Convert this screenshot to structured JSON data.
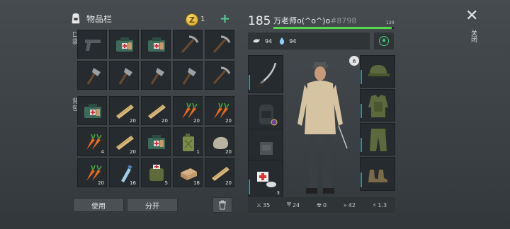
{
  "inventory": {
    "title": "物品栏",
    "coins": "1",
    "plus_label": "+",
    "pocket_label": "口袋",
    "backpack_label": "背包",
    "pocket_rows": [
      [
        {
          "icon": "pistol-icon",
          "count": ""
        },
        {
          "icon": "medkit-bag-icon",
          "count": ""
        },
        {
          "icon": "medkit-bag-icon",
          "count": ""
        },
        {
          "icon": "pickaxe-icon",
          "count": ""
        },
        {
          "icon": "pickaxe-icon",
          "count": ""
        }
      ],
      [
        {
          "icon": "hatchet-icon",
          "count": ""
        },
        {
          "icon": "hatchet-icon",
          "count": ""
        },
        {
          "icon": "hatchet-icon",
          "count": ""
        },
        {
          "icon": "hatchet-icon",
          "count": ""
        },
        {
          "icon": "pickaxe-icon",
          "count": ""
        }
      ]
    ],
    "backpack_rows": [
      [
        {
          "icon": "medkit-bag-icon",
          "count": ""
        },
        {
          "icon": "wood-plank-icon",
          "count": "20"
        },
        {
          "icon": "wood-plank-icon",
          "count": "20"
        },
        {
          "icon": "carrot-icon",
          "count": "20"
        },
        {
          "icon": "carrot-icon",
          "count": "20"
        }
      ],
      [
        {
          "icon": "carrot-icon",
          "count": "4"
        },
        {
          "icon": "wood-plank-icon",
          "count": "20"
        },
        {
          "icon": "medkit-bag-icon",
          "count": ""
        },
        {
          "icon": "jerrycan-icon",
          "count": "1"
        },
        {
          "icon": "stone-icon",
          "count": "20"
        }
      ],
      [
        {
          "icon": "carrot-icon",
          "count": "20"
        },
        {
          "icon": "water-bottle-icon",
          "count": "16"
        },
        {
          "icon": "first-aid-pouch-icon",
          "count": "5"
        },
        {
          "icon": "brick-icon",
          "count": "18"
        },
        {
          "icon": "wood-plank-icon",
          "count": "20"
        }
      ]
    ],
    "use_label": "使用",
    "split_label": "分开"
  },
  "player": {
    "level": "185",
    "name": "万老师o(^o^)o",
    "id": "#8798",
    "xp_max": "120",
    "xp_fraction": 0.98,
    "food": "94",
    "water": "94"
  },
  "equipment": {
    "weapon_icon": "katana-icon",
    "backpack_icon": "backpack-icon",
    "belt_icon": "belt-pouch-icon",
    "consumable_icon": "medicine-icon",
    "consumable_count": "3",
    "head_icon": "military-cap-icon",
    "body_icon": "armored-vest-icon",
    "legs_icon": "cargo-pants-icon",
    "feet_icon": "boots-icon"
  },
  "stats": {
    "attack": "35",
    "defense": "24",
    "radiation": "0",
    "speed": "42",
    "attack_speed": "1.3"
  },
  "close_label": "关闭",
  "colors": {
    "accent_green": "#4bd18d",
    "xp_green": "#56d84c",
    "slot_bg": "#262b2f"
  }
}
